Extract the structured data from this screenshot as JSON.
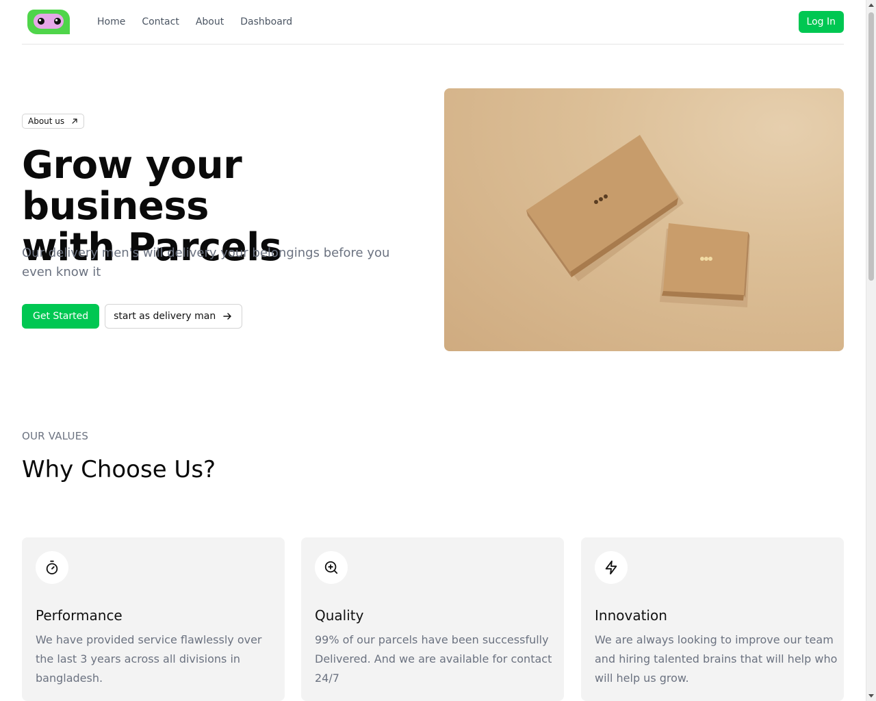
{
  "nav": {
    "links": [
      "Home",
      "Contact",
      "About",
      "Dashboard"
    ],
    "login_label": "Log In",
    "logo_icon": "owl-logo-icon"
  },
  "hero": {
    "badge_label": "About us",
    "badge_icon": "arrow-up-right-icon",
    "title_line1": "Grow your business",
    "title_line2": "with Parcels",
    "subtitle": "Our delivery men's will delivery your belongings before you even know it",
    "primary_button": "Get Started",
    "secondary_button": "start as delivery man",
    "secondary_icon": "arrow-right-icon",
    "image_alt": "two cardboard parcel boxes"
  },
  "values": {
    "eyebrow": "OUR VALUES",
    "title": "Why Choose Us?",
    "cards": [
      {
        "icon": "stopwatch-icon",
        "title": "Performance",
        "text": "We have provided service flawlessly over the last 3 years across all divisions in bangladesh."
      },
      {
        "icon": "zoom-in-icon",
        "title": "Quality",
        "text": "99% of our parcels have been successfully Delivered. And we are available for contact 24/7"
      },
      {
        "icon": "lightning-icon",
        "title": "Innovation",
        "text": "We are always looking to improve our team and hiring talented brains that will help who will help us grow."
      }
    ]
  },
  "colors": {
    "brand_green": "#00c752",
    "text_dark": "#0a0a0a",
    "text_muted": "#6b7280",
    "card_bg": "#f3f3f3"
  }
}
